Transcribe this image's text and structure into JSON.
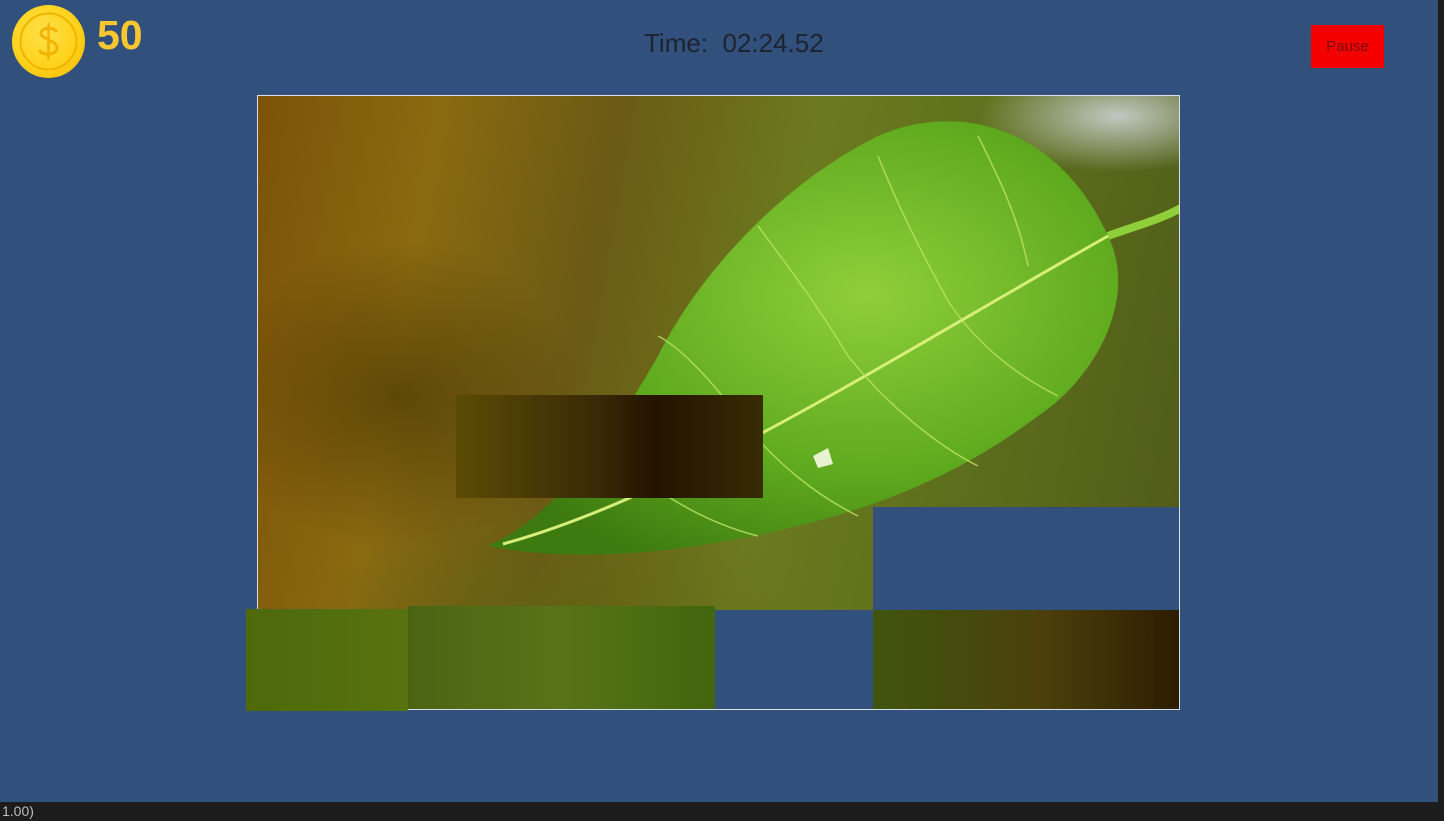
{
  "hud": {
    "coin_icon": "dollar-coin-icon",
    "coin_count": "50",
    "time_label": "Time:  02:24.52",
    "pause_label": "Pause"
  },
  "puzzle": {
    "image_subject": "green leaf on blurred background",
    "tiles_out_of_place": 4,
    "empty_slots": 2
  },
  "console": {
    "text": "1.00)"
  },
  "colors": {
    "background": "#31507c",
    "coin": "#ffd21a",
    "coin_text": "#f7c631",
    "pause_button": "#f40000",
    "board_border": "#d9dde4"
  }
}
